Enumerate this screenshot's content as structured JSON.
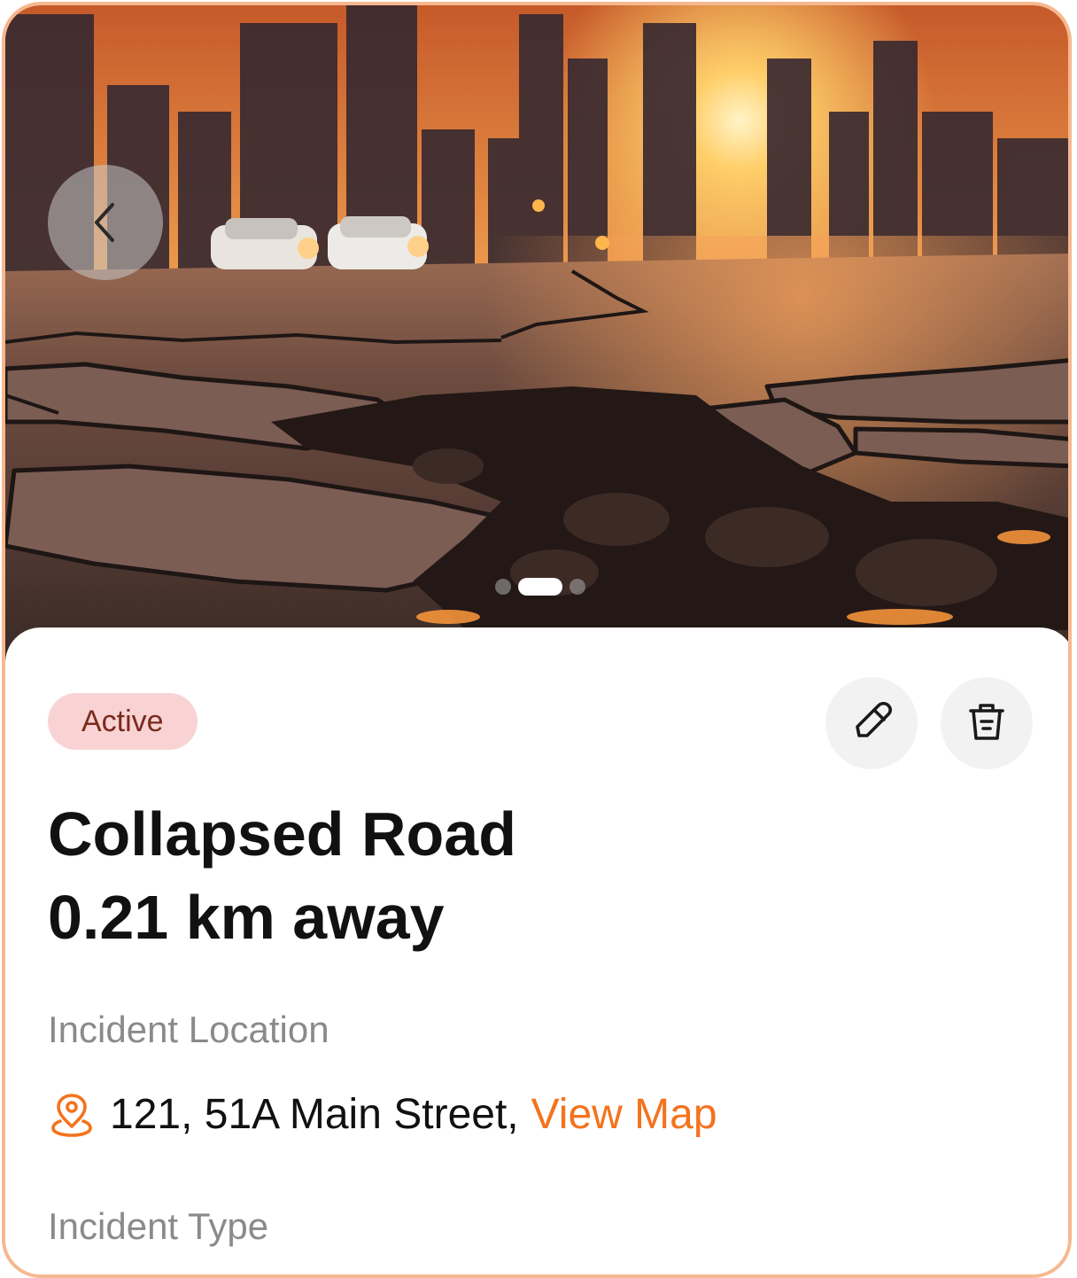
{
  "hero": {
    "image_description_icon": "cracked-road-photo",
    "back_icon": "chevron-left-icon",
    "carousel": {
      "count": 3,
      "active_index": 1
    }
  },
  "incident": {
    "status": "Active",
    "title": "Collapsed Road",
    "distance": "0.21 km away",
    "location_label": "Incident Location",
    "address": "121, 51A Main Street,",
    "view_map": "View Map",
    "type_label": "Incident Type"
  },
  "actions": {
    "edit_icon": "pencil-icon",
    "delete_icon": "trash-icon"
  },
  "colors": {
    "accent": "#f4731d",
    "border": "#f6b88f",
    "badge_bg": "#f9d3d3",
    "badge_text": "#7a2a1c"
  }
}
